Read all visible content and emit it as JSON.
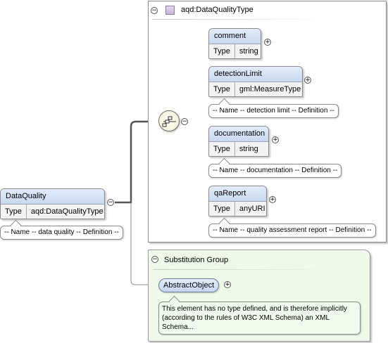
{
  "complex_type": {
    "title": "aqd:DataQualityType",
    "toggle": "−"
  },
  "root_element": {
    "name": "DataQuality",
    "type_key": "Type",
    "type_value": "aqd:DataQualityType",
    "annotation": "-- Name -- data quality -- Definition --",
    "toggle": "−"
  },
  "sequence": {
    "icon": "sequence-compositor-icon",
    "toggle": "−"
  },
  "children": [
    {
      "name": "comment",
      "type_key": "Type",
      "type_value": "string",
      "toggle": "+",
      "annotation": ""
    },
    {
      "name": "detectionLimit",
      "type_key": "Type",
      "type_value": "gml:MeasureType",
      "toggle": "+",
      "annotation": "-- Name -- detection limit -- Definition --"
    },
    {
      "name": "documentation",
      "type_key": "Type",
      "type_value": "string",
      "toggle": "+",
      "annotation": "-- Name -- documentation -- Definition --"
    },
    {
      "name": "qaReport",
      "type_key": "Type",
      "type_value": "anyURI",
      "toggle": "+",
      "annotation": "-- Name -- quality assessment report -- Definition --"
    }
  ],
  "substitution_group": {
    "title": "Substitution Group",
    "toggle": "−",
    "element": "AbstractObject",
    "element_toggle": "+",
    "annotation": "This element has no type defined, and is therefore implicitly (according to the rules of W3C XML Schema) an XML Schema..."
  },
  "colors": {
    "element_header": "#d4e0f5",
    "panel_green": "#eef9ea",
    "connector": "#555555"
  }
}
